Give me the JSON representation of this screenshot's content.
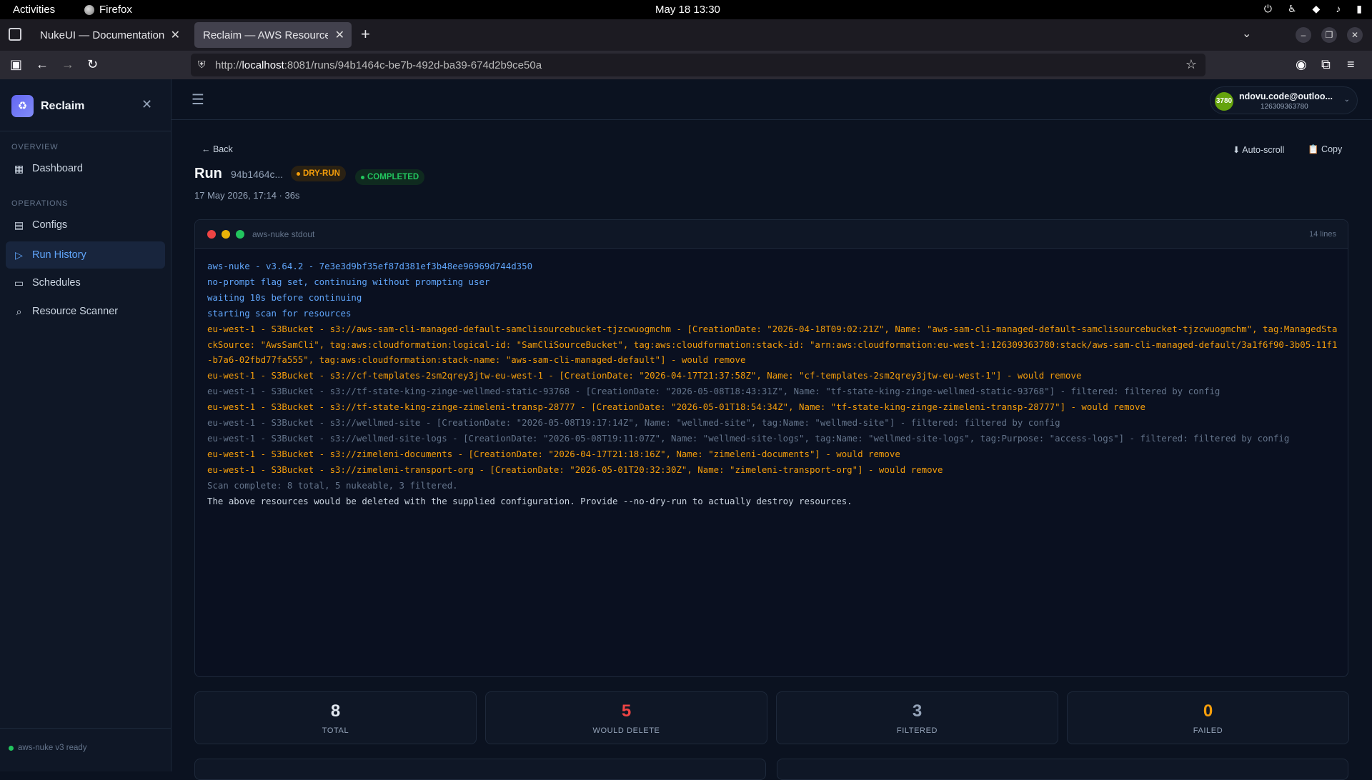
{
  "system_bar": {
    "activities": "Activities",
    "app_name": "Firefox",
    "clock": "May 18  13:30"
  },
  "browser": {
    "tabs": [
      {
        "label": "NukeUI — Documentation"
      },
      {
        "label": "Reclaim — AWS Resource Co"
      }
    ],
    "url_prefix": "http://",
    "url_host": "localhost",
    "url_rest": ":8081/runs/94b1464c-be7b-492d-ba39-674d2b9ce50a"
  },
  "sidebar": {
    "brand": "Reclaim",
    "sections": {
      "overview": "OVERVIEW",
      "operations": "OPERATIONS"
    },
    "items": [
      {
        "label": "Dashboard",
        "icon": "grid-icon"
      },
      {
        "label": "Configs",
        "icon": "file-icon"
      },
      {
        "label": "Run History",
        "icon": "play-circle-icon",
        "active": true
      },
      {
        "label": "Schedules",
        "icon": "calendar-icon"
      },
      {
        "label": "Resource Scanner",
        "icon": "search-icon"
      }
    ],
    "footer_status": "aws-nuke v3 ready"
  },
  "account": {
    "avatar_text": "3780",
    "email": "ndovu.code@outloo...",
    "account_id": "126309363780"
  },
  "run": {
    "back_label": "← Back",
    "auto_scroll_label": "Auto-scroll",
    "copy_label": "Copy",
    "title": "Run",
    "short_id": "94b1464c...",
    "mode_badge": "DRY-RUN",
    "status_badge": "COMPLETED",
    "meta": "17 May 2026, 17:14 · 36s"
  },
  "terminal": {
    "title": "aws-nuke stdout",
    "line_count": "14 lines",
    "lines": [
      {
        "kind": "info",
        "text": "aws-nuke - v3.64.2 - 7e3e3d9bf35ef87d381ef3b48ee96969d744d350"
      },
      {
        "kind": "info",
        "text": "no-prompt flag set, continuing without prompting user"
      },
      {
        "kind": "info",
        "text": "waiting 10s before continuing"
      },
      {
        "kind": "info",
        "text": "starting scan for resources"
      },
      {
        "kind": "remove",
        "text": "eu-west-1 - S3Bucket - s3://aws-sam-cli-managed-default-samclisourcebucket-tjzcwuogmchm - [CreationDate: \"2026-04-18T09:02:21Z\", Name: \"aws-sam-cli-managed-default-samclisourcebucket-tjzcwuogmchm\", tag:ManagedStackSource: \"AwsSamCli\", tag:aws:cloudformation:logical-id: \"SamCliSourceBucket\", tag:aws:cloudformation:stack-id: \"arn:aws:cloudformation:eu-west-1:126309363780:stack/aws-sam-cli-managed-default/3a1f6f90-3b05-11f1-b7a6-02fbd77fa555\", tag:aws:cloudformation:stack-name: \"aws-sam-cli-managed-default\"] - would remove"
      },
      {
        "kind": "remove",
        "text": "eu-west-1 - S3Bucket - s3://cf-templates-2sm2qrey3jtw-eu-west-1 - [CreationDate: \"2026-04-17T21:37:58Z\", Name: \"cf-templates-2sm2qrey3jtw-eu-west-1\"] - would remove"
      },
      {
        "kind": "filtered",
        "text": "eu-west-1 - S3Bucket - s3://tf-state-king-zinge-wellmed-static-93768 - [CreationDate: \"2026-05-08T18:43:31Z\", Name: \"tf-state-king-zinge-wellmed-static-93768\"] - filtered: filtered by config"
      },
      {
        "kind": "remove",
        "text": "eu-west-1 - S3Bucket - s3://tf-state-king-zinge-zimeleni-transp-28777 - [CreationDate: \"2026-05-01T18:54:34Z\", Name: \"tf-state-king-zinge-zimeleni-transp-28777\"] - would remove"
      },
      {
        "kind": "filtered",
        "text": "eu-west-1 - S3Bucket - s3://wellmed-site - [CreationDate: \"2026-05-08T19:17:14Z\", Name: \"wellmed-site\", tag:Name: \"wellmed-site\"] - filtered: filtered by config"
      },
      {
        "kind": "filtered",
        "text": "eu-west-1 - S3Bucket - s3://wellmed-site-logs - [CreationDate: \"2026-05-08T19:11:07Z\", Name: \"wellmed-site-logs\", tag:Name: \"wellmed-site-logs\", tag:Purpose: \"access-logs\"] - filtered: filtered by config"
      },
      {
        "kind": "remove",
        "text": "eu-west-1 - S3Bucket - s3://zimeleni-documents - [CreationDate: \"2026-04-17T21:18:16Z\", Name: \"zimeleni-documents\"] - would remove"
      },
      {
        "kind": "remove",
        "text": "eu-west-1 - S3Bucket - s3://zimeleni-transport-org - [CreationDate: \"2026-05-01T20:32:30Z\", Name: \"zimeleni-transport-org\"] - would remove"
      },
      {
        "kind": "summary",
        "text": "Scan complete: 8 total, 5 nukeable, 3 filtered."
      },
      {
        "kind": "plain",
        "text": "The above resources would be deleted with the supplied configuration. Provide --no-dry-run to actually destroy resources."
      }
    ]
  },
  "stats": [
    {
      "value": "8",
      "label": "TOTAL",
      "color": "#e2e8f0"
    },
    {
      "value": "5",
      "label": "WOULD DELETE",
      "color": "#ef4444"
    },
    {
      "value": "3",
      "label": "FILTERED",
      "color": "#94a3b8"
    },
    {
      "value": "0",
      "label": "FAILED",
      "color": "#f59e0b"
    }
  ],
  "colors": {
    "accent": "#60a5fa",
    "warning": "#f59e0b",
    "success": "#22c55e",
    "danger": "#ef4444"
  }
}
